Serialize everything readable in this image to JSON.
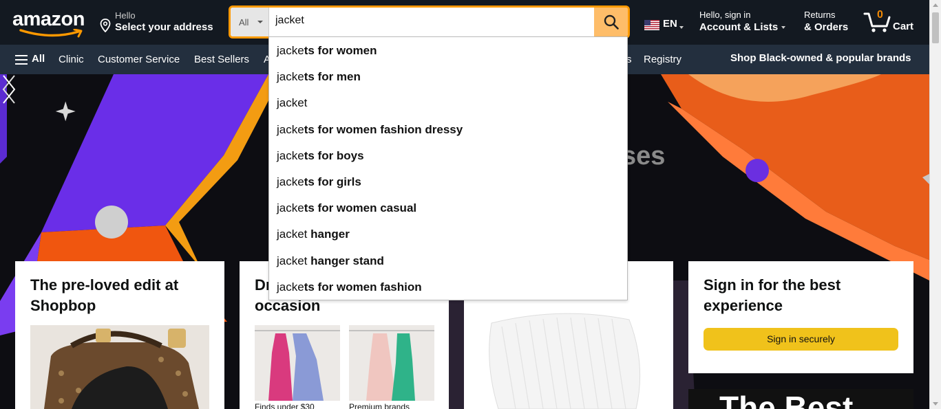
{
  "header": {
    "logo_text": "amazon",
    "address_line1": "Hello",
    "address_line2": "Select your address",
    "search": {
      "category": "All",
      "query": "jacket"
    },
    "language": "EN",
    "account_line1": "Hello, sign in",
    "account_line2": "Account & Lists",
    "returns_line1": "Returns",
    "returns_line2": "& Orders",
    "cart_count": "0",
    "cart_label": "Cart"
  },
  "subnav": {
    "all_label": "All",
    "items": [
      "Clinic",
      "Customer Service",
      "Best Sellers",
      "A",
      "s",
      "Registry"
    ],
    "promo": "Shop Black-owned & popular brands"
  },
  "hero": {
    "partial_text": "ses"
  },
  "cards": [
    {
      "title_line1": "The pre-loved edit at",
      "title_line2": "Shopbop"
    },
    {
      "title_line1": "Dr",
      "title_line2": "occasion",
      "captions": [
        "Finds under $30",
        "Premium brands"
      ]
    },
    {
      "title_line1": "Sign in for the best",
      "title_line2": "experience",
      "button": "Sign in securely"
    },
    {
      "partial_text": "The Best"
    }
  ],
  "suggestions": [
    {
      "typed": "jacke",
      "rest": "ts for women"
    },
    {
      "typed": "jacke",
      "rest": "ts for men"
    },
    {
      "typed": "jacket",
      "rest": ""
    },
    {
      "typed": "jacke",
      "rest": "ts for women fashion dressy"
    },
    {
      "typed": "jacke",
      "rest": "ts for boys"
    },
    {
      "typed": "jacke",
      "rest": "ts for girls"
    },
    {
      "typed": "jacke",
      "rest": "ts for women casual"
    },
    {
      "typed": "jacket",
      "rest": " hanger"
    },
    {
      "typed": "jacket",
      "rest": " hanger stand"
    },
    {
      "typed": "jacke",
      "rest": "ts for women fashion"
    }
  ],
  "icons": {
    "location": "location-pin-icon",
    "search": "search-icon",
    "flag": "us-flag-icon",
    "cart": "cart-icon",
    "menu": "hamburger-menu-icon",
    "prev": "chevron-left-icon",
    "next": "chevron-right-icon"
  },
  "colors": {
    "nav_bg": "#131921",
    "subnav_bg": "#232f3e",
    "search_border": "#ff9900",
    "search_button": "#febd69",
    "cart_count": "#f08804",
    "signin_button": "#f0c21b"
  }
}
